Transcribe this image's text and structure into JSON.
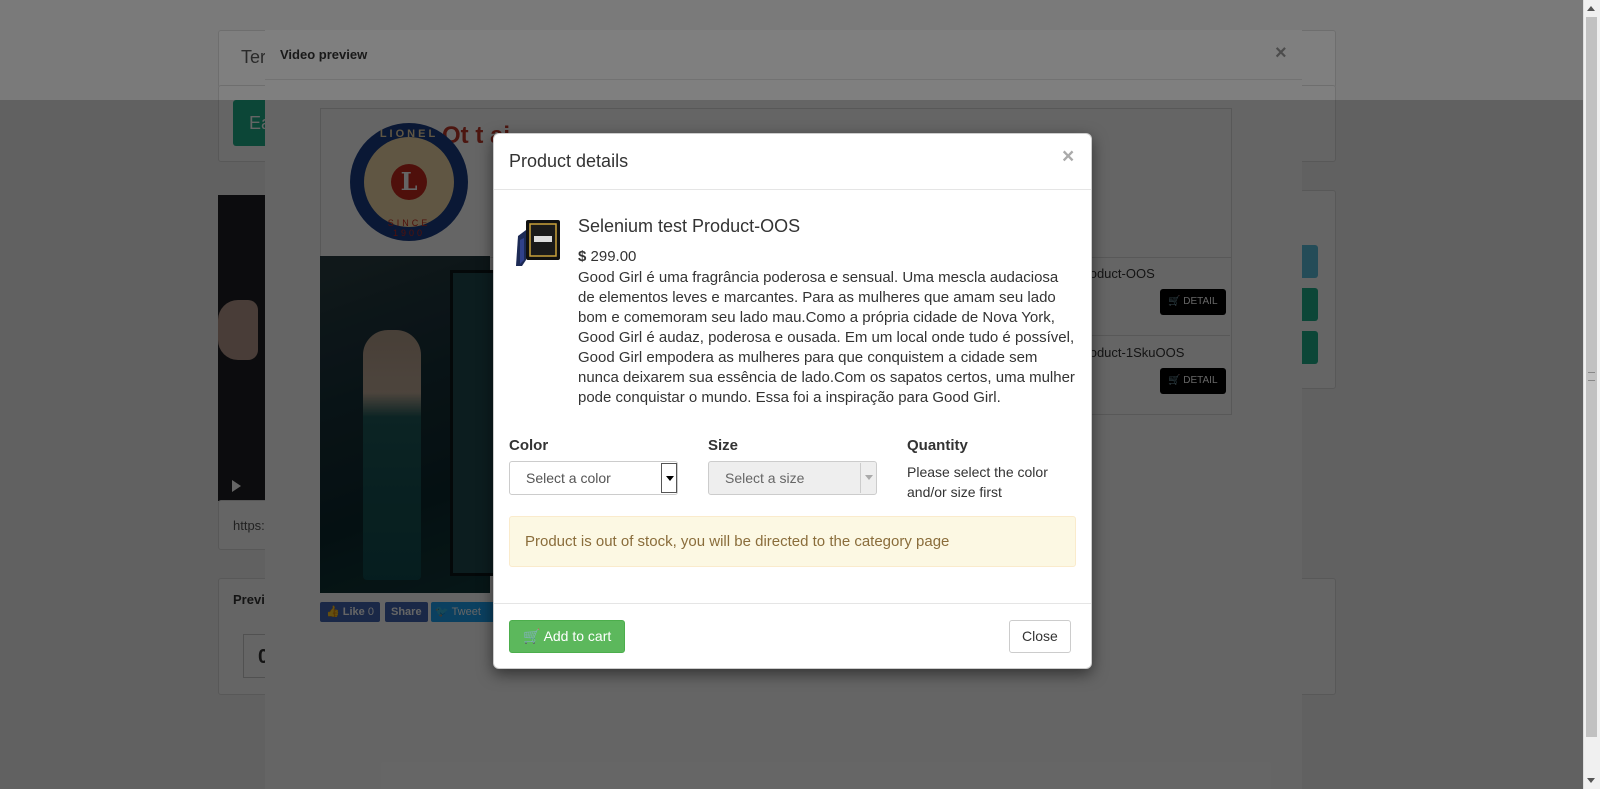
{
  "page": {
    "title_fragment": "Ter",
    "green_button_fragment": "Ea",
    "url_fragment": "https:",
    "preview_fragment": "Previ",
    "counter_fragment": "0"
  },
  "video_modal": {
    "title": "Video preview",
    "close_label": "×",
    "store_title_fragment": "Ot t ai",
    "logo_text_top": "LIONEL",
    "logo_letter": "L",
    "logo_text_bottom": "SINCE 1900",
    "social": {
      "like_label": "Like",
      "like_count": "0",
      "share_label": "Share",
      "tweet_label": "Tweet"
    },
    "items": [
      {
        "name_fragment": "st Product-OOS",
        "detail_label": "DETAIL"
      },
      {
        "name_fragment": "st Product-1SkuOOS",
        "detail_label": "DETAIL"
      }
    ]
  },
  "product_modal": {
    "title": "Product details",
    "close_label": "×",
    "product_name": "Selenium test Product-OOS",
    "currency": "$",
    "price": "299.00",
    "description": "Good Girl é uma fragrância poderosa e sensual. Uma mescla audaciosa de elementos leves e marcantes. Para as mulheres que amam seu lado bom e comemoram seu lado mau.Como a própria cidade de Nova York, Good Girl é audaz, poderosa e ousada. Em um local onde tudo é possível, Good Girl empodera as mulheres para que conquistem a cidade sem nunca deixarem sua essência de lado.Com os sapatos certos, uma mulher pode conquistar o mundo. Essa foi a inspiração para Good Girl.",
    "color_label": "Color",
    "color_placeholder": "Select a color",
    "size_label": "Size",
    "size_placeholder": "Select a size",
    "quantity_label": "Quantity",
    "quantity_note": "Please select the color and/or size first",
    "alert_text": "Product is out of stock, you will be directed to the category page",
    "add_to_cart_label": "Add to cart",
    "close_button_label": "Close"
  },
  "colors": {
    "primary_green": "#5cb85c",
    "teal": "#1fb08a",
    "alert_bg": "#fcf8e3",
    "alert_text": "#8a6d3b",
    "store_red": "#c0392b"
  },
  "icons": {
    "cart": "shopping-cart-icon",
    "close": "close-icon",
    "play": "play-icon",
    "facebook": "facebook-thumb-icon",
    "twitter": "twitter-bird-icon"
  }
}
